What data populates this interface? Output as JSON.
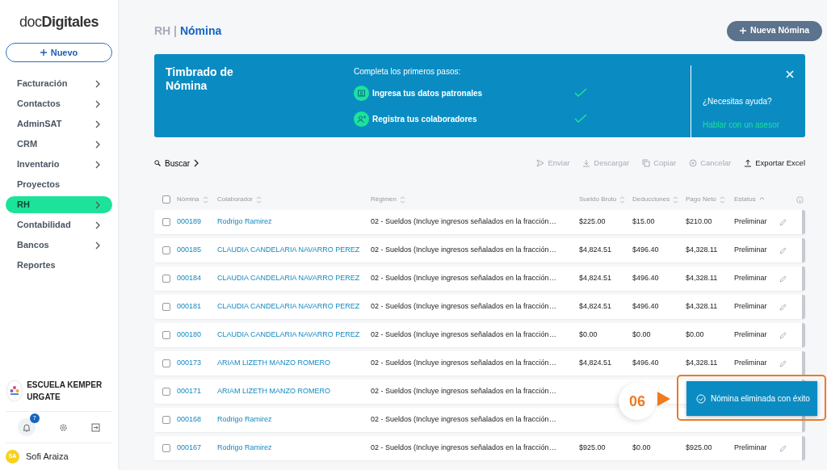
{
  "sidebar": {
    "logo": "doc**Digitales**",
    "new_button": "Nuevo",
    "items": [
      {
        "label": "Facturación",
        "chevron": true,
        "selected": false
      },
      {
        "label": "Contactos",
        "chevron": true,
        "selected": false
      },
      {
        "label": "AdminSAT",
        "chevron": true,
        "selected": false
      },
      {
        "label": "CRM",
        "chevron": true,
        "selected": false
      },
      {
        "label": "Inventario",
        "chevron": true,
        "selected": false
      },
      {
        "label": "Proyectos",
        "chevron": false,
        "selected": false
      },
      {
        "label": "RH",
        "chevron": true,
        "selected": true
      },
      {
        "label": "Contabilidad",
        "chevron": true,
        "selected": false
      },
      {
        "label": "Bancos",
        "chevron": true,
        "selected": false
      },
      {
        "label": "Reportes",
        "chevron": false,
        "selected": false
      }
    ],
    "organization": "ESCUELA KEMPER URGATE",
    "notifications": "7",
    "user": {
      "initials": "SA",
      "name": "Sofi Araiza"
    }
  },
  "header": {
    "section": "RH",
    "separator": "|",
    "title": "Nómina",
    "button": "Nueva Nómina"
  },
  "banner": {
    "title": "Timbrado de Nómina",
    "subtitle": "Completa los primeros pasos:",
    "steps": [
      {
        "label": "Ingresa tus datos patronales",
        "kind": "card",
        "done": true
      },
      {
        "label": "Registra tus colaboradores",
        "kind": "person",
        "done": true
      }
    ],
    "help": "¿Necesitas ayuda?",
    "link": "Hablar con un asesor"
  },
  "toolbar": {
    "search": "Buscar",
    "actions": [
      {
        "label": "Enviar",
        "kind": "send",
        "disabled": true
      },
      {
        "label": "Descargar",
        "kind": "download",
        "disabled": true
      },
      {
        "label": "Copiar",
        "kind": "copy",
        "disabled": true
      },
      {
        "label": "Cancelar",
        "kind": "cancel",
        "disabled": true
      },
      {
        "label": "Exportar Excel",
        "kind": "upload",
        "disabled": false
      }
    ]
  },
  "table": {
    "header_checked": false,
    "columns": [
      {
        "label": "Nómina",
        "sorted_ascending": false
      },
      {
        "label": "Colaborador",
        "sorted_ascending": false
      },
      {
        "label": "Régimen",
        "sorted_ascending": false
      },
      {
        "label": "Sueldo Bruto",
        "sorted_ascending": false
      },
      {
        "label": "Deducciones",
        "sorted_ascending": false
      },
      {
        "label": "Pago Neto",
        "sorted_ascending": false
      },
      {
        "label": "Estatus",
        "sorted_ascending": true
      }
    ],
    "rows": [
      {
        "id": "000189",
        "name": "Rodrigo Ramirez",
        "regime": "02 - Sueldos (Incluye ingresos señalados en la fracción…",
        "gross": "$225.00",
        "deductions": "$15.00",
        "net": "$210.00",
        "status": "Preliminar",
        "checked": false
      },
      {
        "id": "000185",
        "name": "CLAUDIA CANDELARIA NAVARRO PEREZ",
        "regime": "02 - Sueldos (Incluye ingresos señalados en la fracción…",
        "gross": "$4,824.51",
        "deductions": "$496.40",
        "net": "$4,328.11",
        "status": "Preliminar",
        "checked": false
      },
      {
        "id": "000184",
        "name": "CLAUDIA CANDELARIA NAVARRO PEREZ",
        "regime": "02 - Sueldos (Incluye ingresos señalados en la fracción…",
        "gross": "$4,824.51",
        "deductions": "$496.40",
        "net": "$4,328.11",
        "status": "Preliminar",
        "checked": false
      },
      {
        "id": "000181",
        "name": "CLAUDIA CANDELARIA NAVARRO PEREZ",
        "regime": "02 - Sueldos (Incluye ingresos señalados en la fracción…",
        "gross": "$4,824.51",
        "deductions": "$496.40",
        "net": "$4,328.11",
        "status": "Preliminar",
        "checked": false
      },
      {
        "id": "000180",
        "name": "CLAUDIA CANDELARIA NAVARRO PEREZ",
        "regime": "02 - Sueldos (Incluye ingresos señalados en la fracción…",
        "gross": "$0.00",
        "deductions": "$0.00",
        "net": "$0.00",
        "status": "Preliminar",
        "checked": false
      },
      {
        "id": "000173",
        "name": "ARIAM LIZETH MANZO ROMERO",
        "regime": "02 - Sueldos (Incluye ingresos señalados en la fracción…",
        "gross": "$4,824.51",
        "deductions": "$496.40",
        "net": "$4,328.11",
        "status": "Preliminar",
        "checked": false
      },
      {
        "id": "000171",
        "name": "ARIAM LIZETH MANZO ROMERO",
        "regime": "02 - Sueldos (Incluye ingresos señalados en la fracción…",
        "checked": false
      },
      {
        "id": "000168",
        "name": "Rodrigo Ramirez",
        "regime": "02 - Sueldos (Incluye ingresos señalados en la fracción…",
        "checked": false
      },
      {
        "id": "000167",
        "name": "Rodrigo Ramirez",
        "regime": "02 - Sueldos (Incluye ingresos señalados en la fracción…",
        "gross": "$925.00",
        "deductions": "$0.00",
        "net": "$925.00",
        "status": "Preliminar",
        "checked": false
      }
    ]
  },
  "toast": {
    "message": "Nómina eliminada con éxito",
    "step": "06"
  }
}
